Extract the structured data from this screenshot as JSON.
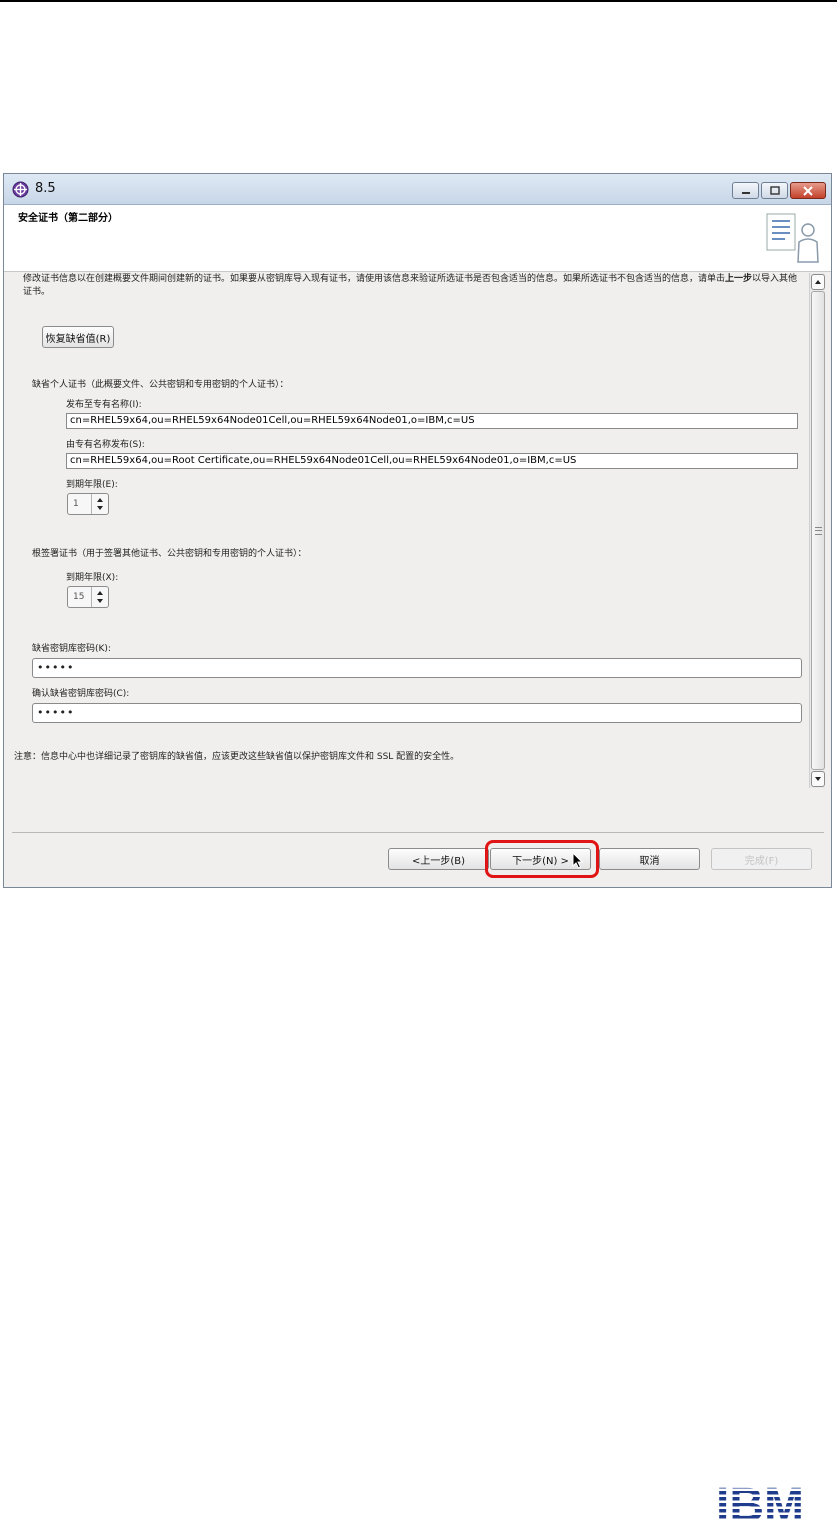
{
  "window": {
    "title": "8.5",
    "minimize_icon": "minimize-icon",
    "maximize_icon": "maximize-icon",
    "close_icon": "close-icon"
  },
  "header": {
    "title": "安全证书（第二部分）"
  },
  "intro": {
    "text_part1": "修改证书信息以在创建概要文件期间创建新的证书。如果要从密钥库导入现有证书，请使用该信息来验证所选证书是否包含适当的信息。如果所选证书不包含适当的信息，请单击",
    "bold_link": "上一步",
    "text_part2": "以导入其他证书。"
  },
  "restore_button": "恢复缺省值(R)",
  "personal_cert": {
    "section_label": "缺省个人证书（此概要文件、公共密钥和专用密钥的个人证书）：",
    "issued_to_label": "发布至专有名称(I):",
    "issued_to_value": "cn=RHEL59x64,ou=RHEL59x64Node01Cell,ou=RHEL59x64Node01,o=IBM,c=US",
    "issued_by_label": "由专有名称发布(S):",
    "issued_by_value": "cn=RHEL59x64,ou=Root Certificate,ou=RHEL59x64Node01Cell,ou=RHEL59x64Node01,o=IBM,c=US",
    "expiration_label": "到期年限(E):",
    "expiration_value": "1"
  },
  "root_cert": {
    "section_label": "根签署证书（用于签署其他证书、公共密钥和专用密钥的个人证书）：",
    "expiration_label": "到期年限(X):",
    "expiration_value": "15"
  },
  "keystore": {
    "password_label": "缺省密钥库密码(K):",
    "password_value": "•••••",
    "confirm_label": "确认缺省密钥库密码(C):",
    "confirm_value": "•••••"
  },
  "note": "注意：信息中心中也详细记录了密钥库的缺省值，应该更改这些缺省值以保护密钥库文件和 SSL 配置的安全性。",
  "footer": {
    "back": "<上一步(B)",
    "next": "下一步(N) >",
    "cancel": "取消",
    "finish": "完成(F)"
  },
  "colors": {
    "highlight": "#e01414",
    "ibm_blue": "#1f3c8c"
  },
  "logo": "IBM"
}
